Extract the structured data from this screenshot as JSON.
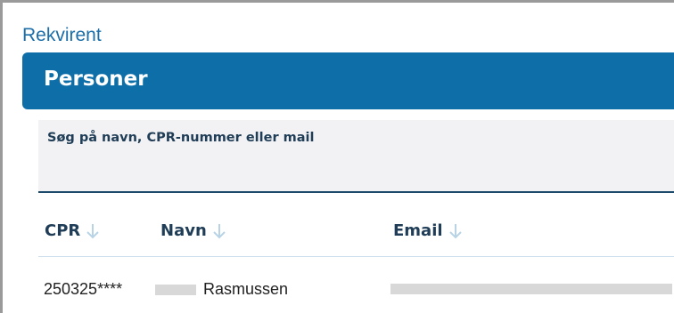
{
  "breadcrumb": {
    "label": "Rekvirent"
  },
  "panel": {
    "title": "Personer"
  },
  "search": {
    "label": "Søg på navn, CPR-nummer eller mail",
    "value": ""
  },
  "table": {
    "columns": [
      {
        "label": "CPR",
        "sort_icon": "arrow-down-icon"
      },
      {
        "label": "Navn",
        "sort_icon": "arrow-down-icon"
      },
      {
        "label": "Email",
        "sort_icon": "arrow-down-icon"
      }
    ],
    "rows": [
      {
        "cpr": "250325****",
        "name": "Rasmussen",
        "email": ""
      }
    ]
  },
  "colors": {
    "accent": "#0e6fa8",
    "link": "#1b6ea8",
    "heading": "#1f3d56",
    "sort_icon": "#b9d3e6"
  }
}
